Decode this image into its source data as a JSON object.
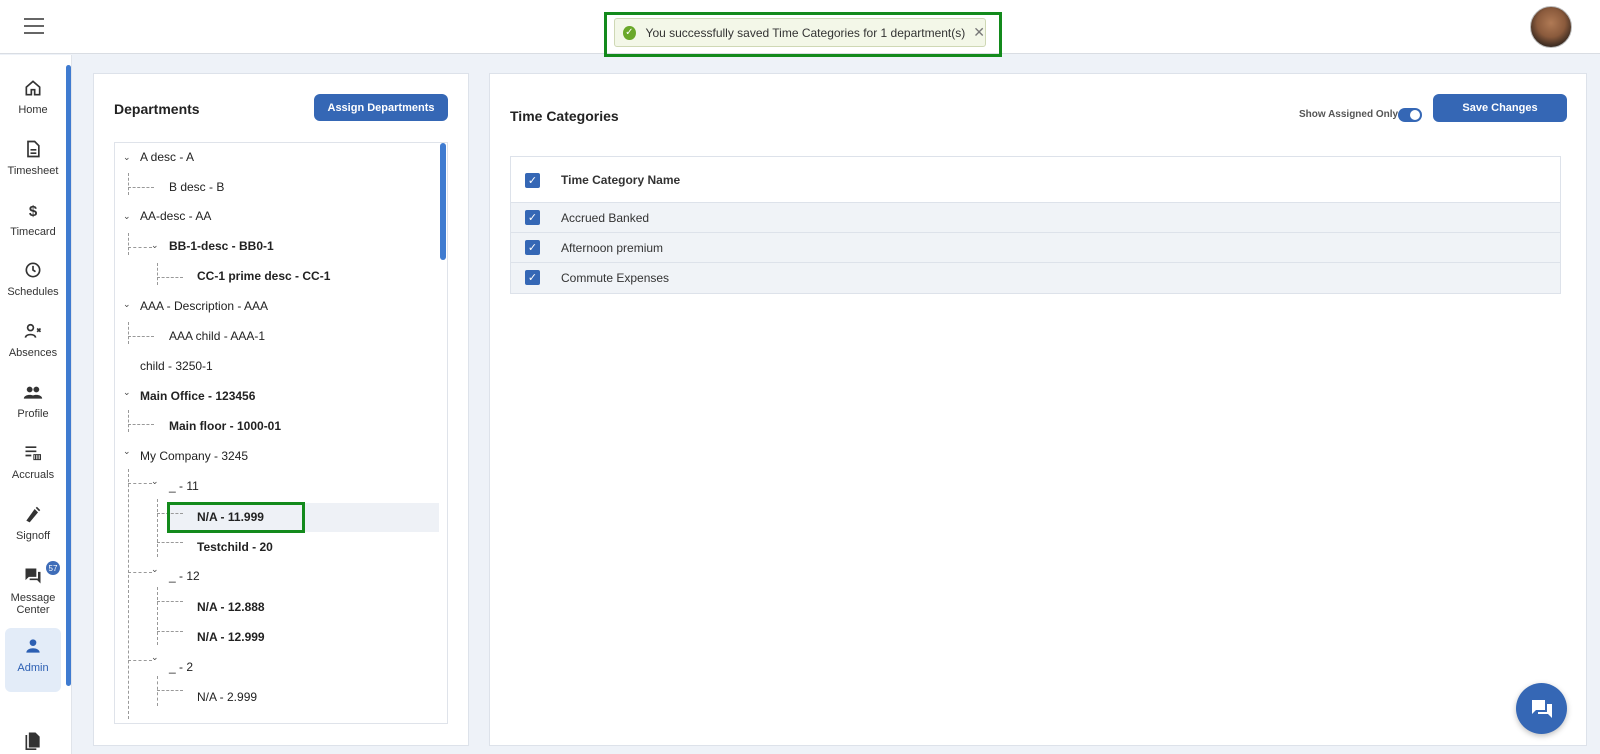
{
  "toast": {
    "message": "You successfully saved Time Categories for 1 department(s)",
    "close": "✕"
  },
  "nav": {
    "home": "Home",
    "timesheet": "Timesheet",
    "timecard": "Timecard",
    "schedules": "Schedules",
    "absences": "Absences",
    "profile": "Profile",
    "accruals": "Accruals",
    "signoff": "Signoff",
    "message_center": "Message Center",
    "message_badge": "57",
    "admin": "Admin"
  },
  "departments": {
    "title": "Departments",
    "assign_button": "Assign Departments",
    "tree": [
      {
        "label": "A desc - A"
      },
      {
        "label": "B desc - B"
      },
      {
        "label": "AA-desc - AA"
      },
      {
        "label": "BB-1-desc - BB0-1"
      },
      {
        "label": "CC-1 prime desc - CC-1"
      },
      {
        "label": "AAA - Description - AAA"
      },
      {
        "label": "AAA child - AAA-1"
      },
      {
        "label": "child - 3250-1"
      },
      {
        "label": "Main Office - 123456"
      },
      {
        "label": "Main floor - 1000-01"
      },
      {
        "label": "My Company - 3245"
      },
      {
        "label": "_ - 11"
      },
      {
        "label": "N/A - 11.999"
      },
      {
        "label": "Testchild - 20"
      },
      {
        "label": "_ - 12"
      },
      {
        "label": "N/A - 12.888"
      },
      {
        "label": "N/A - 12.999"
      },
      {
        "label": "_ - 2"
      },
      {
        "label": "N/A - 2.999"
      }
    ]
  },
  "time_categories": {
    "title": "Time Categories",
    "toggle_label": "Show Assigned Only",
    "save_button": "Save Changes",
    "column_header": "Time Category Name",
    "rows": [
      {
        "name": "Accrued Banked"
      },
      {
        "name": "Afternoon premium"
      },
      {
        "name": "Commute Expenses"
      }
    ]
  },
  "colors": {
    "primary": "#3567b5",
    "highlight": "#138a1c"
  }
}
